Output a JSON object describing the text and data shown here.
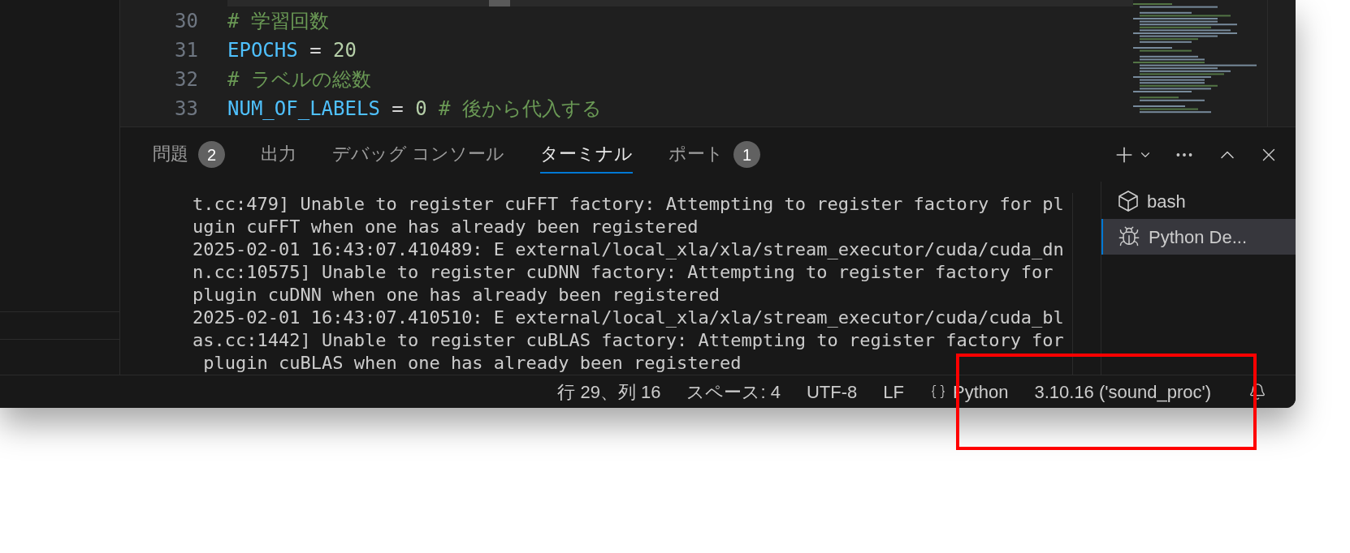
{
  "editor": {
    "lines": [
      {
        "number": "30",
        "tokens": [
          {
            "kind": "comment",
            "text": "# 学習回数"
          }
        ]
      },
      {
        "number": "31",
        "tokens": [
          {
            "kind": "name",
            "text": "EPOCHS"
          },
          {
            "kind": "op",
            "text": " = "
          },
          {
            "kind": "number",
            "text": "20"
          }
        ]
      },
      {
        "number": "32",
        "tokens": [
          {
            "kind": "comment",
            "text": "# ラベルの総数"
          }
        ]
      },
      {
        "number": "33",
        "tokens": [
          {
            "kind": "name",
            "text": "NUM_OF_LABELS"
          },
          {
            "kind": "op",
            "text": " = "
          },
          {
            "kind": "number",
            "text": "0"
          },
          {
            "kind": "comment",
            "text": " # 後から代入する"
          }
        ]
      }
    ]
  },
  "panel": {
    "tabs": [
      {
        "label": "問題",
        "badge": "2",
        "selected": false
      },
      {
        "label": "出力",
        "selected": false
      },
      {
        "label": "デバッグ コンソール",
        "selected": false
      },
      {
        "label": "ターミナル",
        "selected": true
      },
      {
        "label": "ポート",
        "badge": "1",
        "selected": false
      }
    ]
  },
  "terminal": {
    "lines": [
      "t.cc:479] Unable to register cuFFT factory: Attempting to register factory for pl",
      "ugin cuFFT when one has already been registered",
      "2025-02-01 16:43:07.410489: E external/local_xla/xla/stream_executor/cuda/cuda_dn",
      "n.cc:10575] Unable to register cuDNN factory: Attempting to register factory for",
      "plugin cuDNN when one has already been registered",
      "2025-02-01 16:43:07.410510: E external/local_xla/xla/stream_executor/cuda/cuda_bl",
      "as.cc:1442] Unable to register cuBLAS factory: Attempting to register factory for",
      " plugin cuBLAS when one has already been registered"
    ]
  },
  "terminal_list": [
    {
      "kind": "shell",
      "label": "bash",
      "selected": false
    },
    {
      "kind": "debug",
      "label": "Python De...",
      "selected": true
    }
  ],
  "status_bar": {
    "items": [
      {
        "kind": "text",
        "text": "行 29、列 16"
      },
      {
        "kind": "text",
        "text": "スペース: 4"
      },
      {
        "kind": "text",
        "text": "UTF-8"
      },
      {
        "kind": "text",
        "text": "LF"
      },
      {
        "kind": "language",
        "text": "Python"
      },
      {
        "kind": "text",
        "text": "3.10.16 ('sound_proc')"
      }
    ]
  }
}
